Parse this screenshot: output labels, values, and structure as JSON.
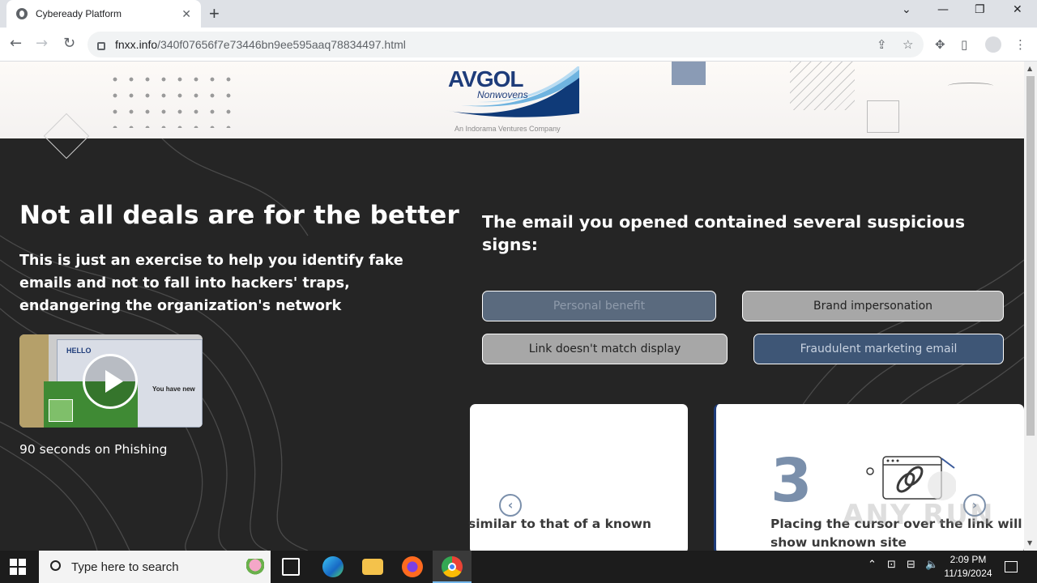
{
  "browser": {
    "tab_title": "Cybeready Platform",
    "tab_close": "✕",
    "new_tab": "+",
    "url_host": "fnxx.info",
    "url_path": "/340f07656f7e73446bn9ee595aaq78834497.html",
    "window_controls": {
      "dropdown": "⌄",
      "minimize": "—",
      "restore": "❐",
      "close": "✕"
    }
  },
  "page": {
    "logo": {
      "brand": "AVGOL",
      "sub": "Nonwovens",
      "tagline": "An Indorama Ventures Company"
    },
    "heading": "Not all deals are for the better",
    "subheading": "This is just an exercise to help you identify fake emails and not to fall into hackers' traps, endangering the organization's network",
    "video": {
      "hello": "HELLO",
      "have_new": "You have new",
      "caption": "90 seconds on Phishing"
    },
    "email_heading": "The email you opened contained several suspicious signs:",
    "signs": [
      {
        "label": "Personal benefit",
        "style": "blue-muted"
      },
      {
        "label": "Brand impersonation",
        "style": "gray"
      },
      {
        "label": "Link doesn't match display",
        "style": "gray"
      },
      {
        "label": "Fraudulent marketing email",
        "style": "blue"
      }
    ],
    "cards": {
      "left_text": "similar to that of a known",
      "right_number": "3",
      "right_text": "Placing the cursor over the link will show unknown site",
      "prev": "‹",
      "next": "›"
    },
    "watermark": "ANY RUN"
  },
  "taskbar": {
    "search_placeholder": "Type here to search",
    "time": "2:09 PM",
    "date": "11/19/2024"
  }
}
